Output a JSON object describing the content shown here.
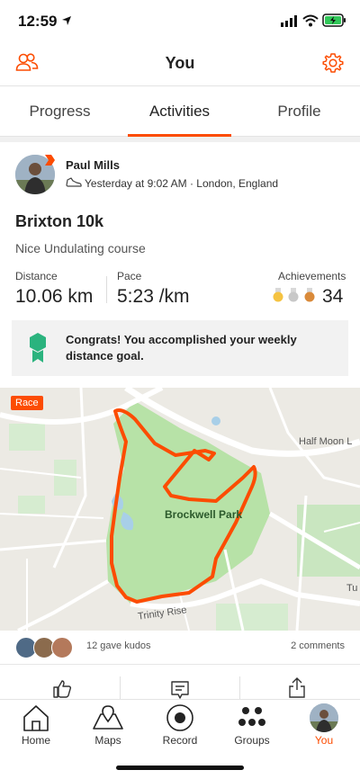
{
  "status_bar": {
    "time": "12:59"
  },
  "header": {
    "title": "You"
  },
  "tabs": [
    {
      "label": "Progress"
    },
    {
      "label": "Activities",
      "active": true
    },
    {
      "label": "Profile"
    }
  ],
  "activity": {
    "athlete_name": "Paul Mills",
    "meta": "Yesterday at 9:02 AM · London, England",
    "title": "Brixton 10k",
    "description": "Nice Undulating course",
    "stats": {
      "distance_label": "Distance",
      "distance_value": "10.06 km",
      "pace_label": "Pace",
      "pace_value": "5:23 /km",
      "achievements_label": "Achievements",
      "achievements_value": "34"
    },
    "congrats": "Congrats! You accomplished your weekly distance goal.",
    "map": {
      "badge": "Race",
      "park_label": "Brockwell Park",
      "road_labels": [
        "Half Moon L",
        "Trinity Rise",
        "Tu"
      ]
    },
    "kudos_text": "12 gave kudos",
    "comments_text": "2 comments"
  },
  "tabbar": [
    {
      "label": "Home",
      "icon": "home-icon"
    },
    {
      "label": "Maps",
      "icon": "map-icon"
    },
    {
      "label": "Record",
      "icon": "record-icon"
    },
    {
      "label": "Groups",
      "icon": "groups-icon"
    },
    {
      "label": "You",
      "icon": "avatar",
      "active": true
    }
  ],
  "colors": {
    "accent": "#fc4c02",
    "gold": "#f5c342",
    "silver": "#c8c8c8",
    "bronze": "#d98a3a",
    "badge_green": "#2bb37e"
  }
}
